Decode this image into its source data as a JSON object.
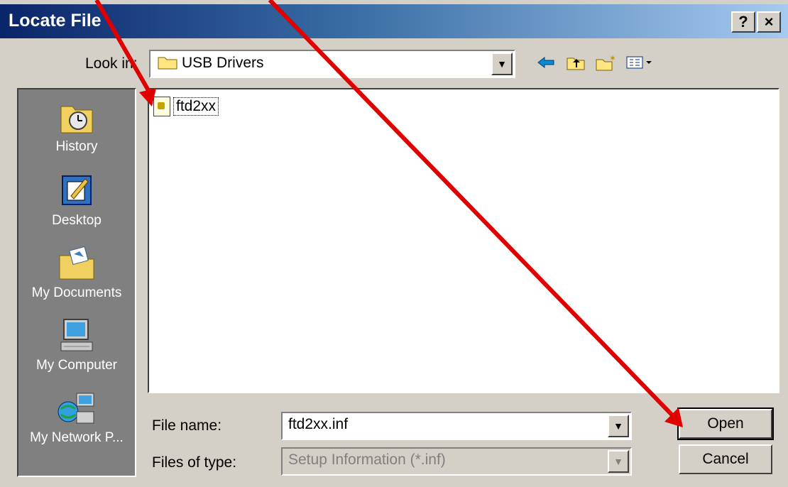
{
  "window": {
    "title": "Locate File",
    "help_label": "?",
    "close_label": "×"
  },
  "lookin": {
    "label": "Look in:",
    "value": "USB Drivers"
  },
  "toolbar": {
    "icons": [
      "back-arrow-icon",
      "up-folder-icon",
      "new-folder-icon",
      "view-menu-icon"
    ]
  },
  "places": [
    {
      "label": "History",
      "icon": "history-icon"
    },
    {
      "label": "Desktop",
      "icon": "desktop-icon"
    },
    {
      "label": "My Documents",
      "icon": "my-documents-icon"
    },
    {
      "label": "My Computer",
      "icon": "my-computer-icon"
    },
    {
      "label": "My Network P...",
      "icon": "my-network-places-icon"
    }
  ],
  "files": [
    {
      "name": "ftd2xx",
      "icon": "setup-info-file-icon"
    }
  ],
  "filename": {
    "label": "File name:",
    "value": "ftd2xx.inf"
  },
  "filetype": {
    "label": "Files of type:",
    "value": "Setup Information (*.inf)"
  },
  "buttons": {
    "open": "Open",
    "cancel": "Cancel"
  },
  "colors": {
    "titlebar_start": "#0a246a",
    "annotation_arrow": "#e00000"
  }
}
